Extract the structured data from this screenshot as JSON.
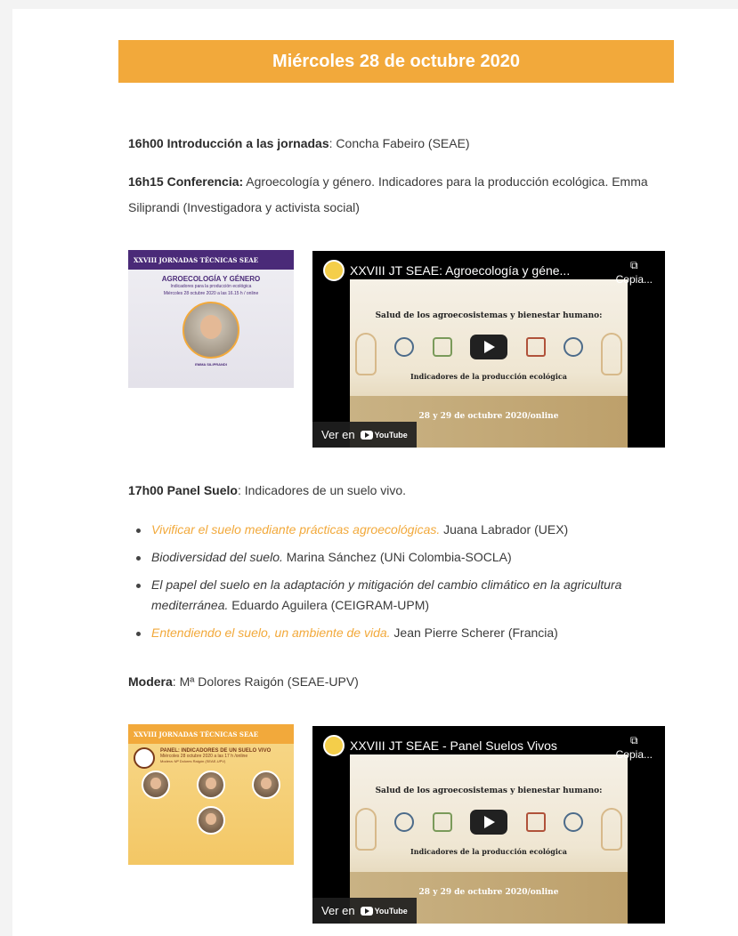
{
  "banner": {
    "title": "Miércoles 28 de octubre 2020"
  },
  "intro": {
    "time": "16h00 Introducción a las jornadas",
    "text": ": Concha Fabeiro (SEAE)"
  },
  "conference": {
    "time": "16h15 Conferencia:",
    "text": " Agroecología y género. Indicadores para la producción ecológica. Emma Siliprandi (Investigadora y activista social)"
  },
  "thumb1": {
    "bar": "XXVIII JORNADAS TÉCNICAS SEAE",
    "heading": "AGROECOLOGÍA Y GÉNERO",
    "sub": "Indicadores para la producción ecológica",
    "date": "Miércoles 28 octubre 2020 a las 16.15 h / online",
    "speaker": "EMMA SILIPRANDI"
  },
  "video1": {
    "title": "XXVIII JT SEAE: Agroecología y géne...",
    "copy_label": "Copia...",
    "heading": "Salud de los agroecosistemas y bienestar humano:",
    "subheading": "Indicadores de la producción ecológica",
    "date": "28 y 29 de octubre 2020/online",
    "watch_label": "Ver en",
    "youtube_label": "YouTube"
  },
  "panel": {
    "time": "17h00 Panel Suelo",
    "text": ": Indicadores de un suelo vivo."
  },
  "talks": [
    {
      "title": "Vivificar el suelo mediante prácticas agroecológicas.",
      "author": " Juana Labrador (UEX)",
      "link": true
    },
    {
      "title": "Biodiversidad del suelo.",
      "author": " Marina Sánchez (UNi Colombia-SOCLA)",
      "link": false
    },
    {
      "title": "El papel del suelo en la adaptación y mitigación del cambio climático en la agricultura mediterránea.",
      "author": " Eduardo Aguilera (CEIGRAM-UPM)",
      "link": false
    },
    {
      "title": "Entendiendo el suelo, un ambiente de vida.",
      "author": " Jean Pierre Scherer (Francia)",
      "link": true
    }
  ],
  "moderator": {
    "label": "Modera",
    "text": ": Mª Dolores Raigón (SEAE-UPV)"
  },
  "thumb2": {
    "bar": "XXVIII JORNADAS TÉCNICAS SEAE",
    "heading": "PANEL: INDICADORES DE UN SUELO VIVO",
    "date": "Miércoles 28 octubre 2020 a las 17 h /online",
    "moderator": "Modera: Mª Dolores Raigón (SEAE-UPV)"
  },
  "video2": {
    "title": "XXVIII JT SEAE - Panel Suelos Vivos",
    "copy_label": "Copia...",
    "heading": "Salud de los agroecosistemas y bienestar humano:",
    "subheading": "Indicadores de la producción ecológica",
    "date": "28 y 29 de octubre 2020/online",
    "watch_label": "Ver en",
    "youtube_label": "YouTube"
  },
  "colors": {
    "accent": "#f2a93b",
    "purple": "#4a2a78"
  }
}
